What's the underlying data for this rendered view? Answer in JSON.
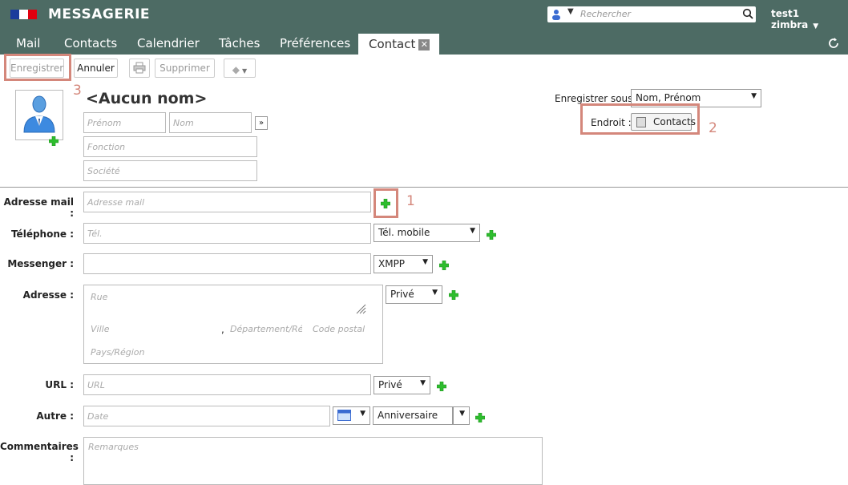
{
  "header": {
    "brand": "MESSAGERIE",
    "search_placeholder": "Rechercher",
    "user": "test1 zimbra",
    "flag_colors": [
      "#1a3c9c",
      "#ffffff",
      "#e1000f"
    ]
  },
  "tabs": [
    {
      "label": "Mail"
    },
    {
      "label": "Contacts"
    },
    {
      "label": "Calendrier"
    },
    {
      "label": "Tâches"
    },
    {
      "label": "Préférences"
    },
    {
      "label": "Contact",
      "active": true
    }
  ],
  "toolbar": {
    "save_label": "Enregistrer",
    "cancel_label": "Annuler",
    "delete_label": "Supprimer"
  },
  "annotations": {
    "n1": "1",
    "n2": "2",
    "n3": "3",
    "color": "#d4877b"
  },
  "contact": {
    "title": "<Aucun nom>",
    "first_name_placeholder": "Prénom",
    "last_name_placeholder": "Nom",
    "expand_label": "»",
    "function_placeholder": "Fonction",
    "company_placeholder": "Société",
    "save_as_label": "Enregistrer sous :",
    "save_as_value": "Nom, Prénom",
    "location_label": "Endroit :",
    "location_value": "Contacts"
  },
  "fields": {
    "email_label": "Adresse mail :",
    "email_placeholder": "Adresse mail",
    "phone_label": "Téléphone :",
    "phone_placeholder": "Tél.",
    "phone_type": "Tél. mobile",
    "messenger_label": "Messenger :",
    "messenger_type": "XMPP",
    "address_label": "Adresse :",
    "street_placeholder": "Rue",
    "city_placeholder": "Ville",
    "comma": ",",
    "region_placeholder": "Département/Rég",
    "postal_placeholder": "Code postal",
    "country_placeholder": "Pays/Région",
    "address_type": "Privé",
    "url_label": "URL :",
    "url_placeholder": "URL",
    "url_type": "Privé",
    "other_label": "Autre :",
    "date_placeholder": "Date",
    "other_type": "Anniversaire",
    "comments_label": "Commentaires :",
    "comments_placeholder": "Remarques"
  }
}
